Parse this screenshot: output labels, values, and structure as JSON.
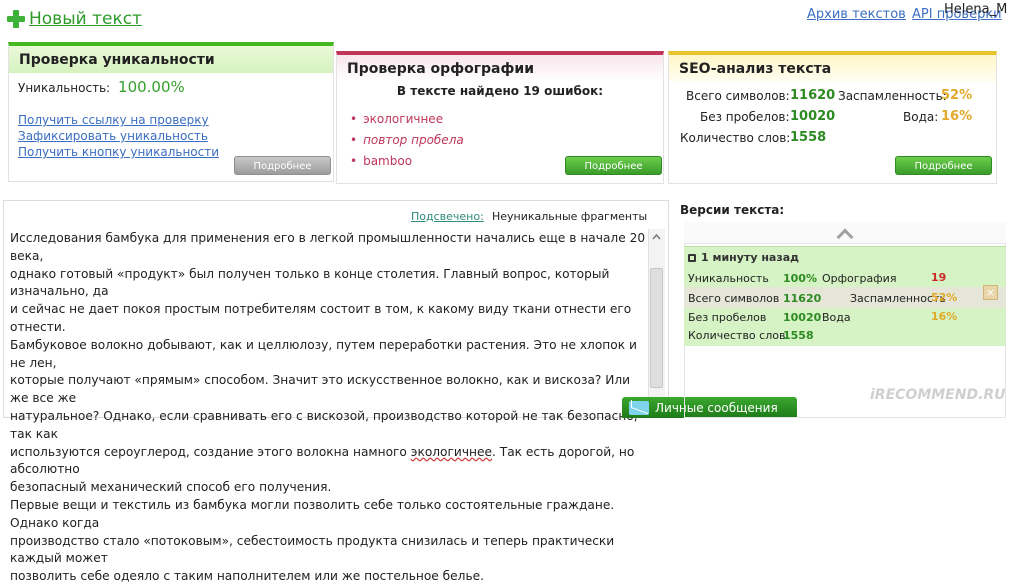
{
  "header": {
    "new_text_label": "Новый текст",
    "archive_link": "Архив текстов",
    "api_link": "API проверки",
    "user_name": "Helena_M"
  },
  "uniqueness_card": {
    "title": "Проверка уникальности",
    "uniqueness_label": "Уникальность:",
    "uniqueness_value": "100.00%",
    "links": [
      "Получить ссылку на проверку",
      "Зафиксировать уникальность",
      "Получить кнопку уникальности"
    ],
    "more_button": "Подробнее"
  },
  "spelling_card": {
    "title": "Проверка орфографии",
    "found_text": "В тексте найдено 19 ошибок:",
    "errors": [
      "экологичнее",
      "повтор пробела",
      "bamboo"
    ],
    "more_button": "Подробнее"
  },
  "seo_card": {
    "title": "SEO-анализ текста",
    "total_chars_label": "Всего символов:",
    "total_chars_value": "11620",
    "no_spaces_label": "Без пробелов:",
    "no_spaces_value": "10020",
    "word_count_label": "Количество слов:",
    "word_count_value": "1558",
    "spam_label": "Заспамленность:",
    "spam_value": "52%",
    "water_label": "Вода:",
    "water_value": "16%",
    "more_button": "Подробнее"
  },
  "text_panel": {
    "highlight_label": "Подсвечено:",
    "nonunique_label": "Неуникальные фрагменты",
    "lines": [
      "Исследования бамбука для применения его в легкой промышленности начались еще в начале 20 века,",
      "однако готовый «продукт» был получен только в конце столетия. Главный вопрос, который изначально, да",
      "и сейчас не дает покоя простым потребителям состоит в том, к какому виду ткани отнести его отнести.",
      "Бамбуковое волокно добывают, как и целлюлозу, путем переработки растения. Это не хлопок и не лен,",
      "которые получают «прямым» способом. Значит это искусственное волокно, как и вискоза? Или же все же",
      "натуральное? Однако, если сравнивать его с вискозой, производство которой не так безопасно, так как",
      "используются сероуглерод, создание этого волокна намного ",
      "безопасный механический способ его получения.",
      "Первые вещи и текстиль из бамбука могли позволить себе только состоятельные граждане. Однако когда",
      "производство стало «потоковым», себестоимость продукта снизилась и теперь практически каждый может",
      "позволить себе одеяло с таким наполнителем или же постельное белье."
    ],
    "underlined_word": "экологичнее",
    "line7_tail": ". Так есть дорогой, но абсолютно"
  },
  "messages_button": "Личные сообщения",
  "versions": {
    "title": "Версии текста:",
    "time": "1 минуту назад",
    "uniqueness_label": "Уникальность",
    "uniqueness_value": "100%",
    "spelling_label": "Орфография",
    "spelling_value": "19",
    "total_chars_label": "Всего символов",
    "total_chars_value": "11620",
    "spam_label": "Заспамленность",
    "spam_value": "52%",
    "no_spaces_label": "Без пробелов",
    "no_spaces_value": "10020",
    "water_label": "Вода",
    "water_value": "16%",
    "word_count_label": "Количество слов",
    "word_count_value": "1558"
  },
  "watermark": "iRECOMMEND.RU",
  "colors": {
    "green_accent": "#43b91f",
    "spelling_accent": "#c0365a",
    "seo_accent": "#e7c42e",
    "value_green": "#2e8a22",
    "percent_orange": "#e0a92a"
  }
}
